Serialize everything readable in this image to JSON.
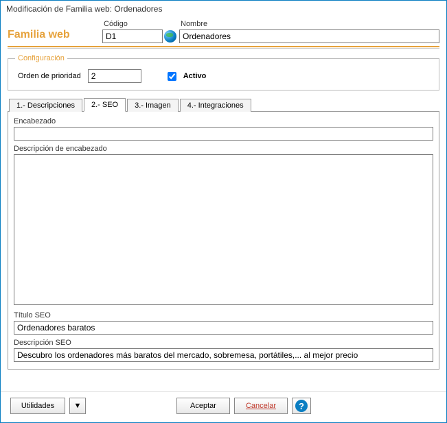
{
  "window": {
    "title": "Modificación de Familia web: Ordenadores"
  },
  "header": {
    "family_label": "Familia web",
    "codigo_label": "Código",
    "codigo_value": "D1",
    "nombre_label": "Nombre",
    "nombre_value": "Ordenadores"
  },
  "config": {
    "legend": "Configuración",
    "orden_label": "Orden de prioridad",
    "orden_value": "2",
    "activo_label": "Activo",
    "activo_checked": true
  },
  "tabs": {
    "t1": "1.- Descripciones",
    "t2": "2.- SEO",
    "t3": "3.- Imagen",
    "t4": "4.- Integraciones",
    "active": "t2"
  },
  "seo": {
    "encabezado_label": "Encabezado",
    "encabezado_value": "",
    "desc_encabezado_label": "Descripción de encabezado",
    "desc_encabezado_value": "",
    "titulo_label": "Título SEO",
    "titulo_value": "Ordenadores baratos",
    "descseo_label": "Descripción SEO",
    "descseo_value": "Descubro los ordenadores más baratos del mercado, sobremesa, portátiles,... al mejor precio"
  },
  "footer": {
    "utilidades": "Utilidades",
    "aceptar": "Aceptar",
    "cancelar": "Cancelar",
    "dropdown_glyph": "▼",
    "help_glyph": "?"
  }
}
